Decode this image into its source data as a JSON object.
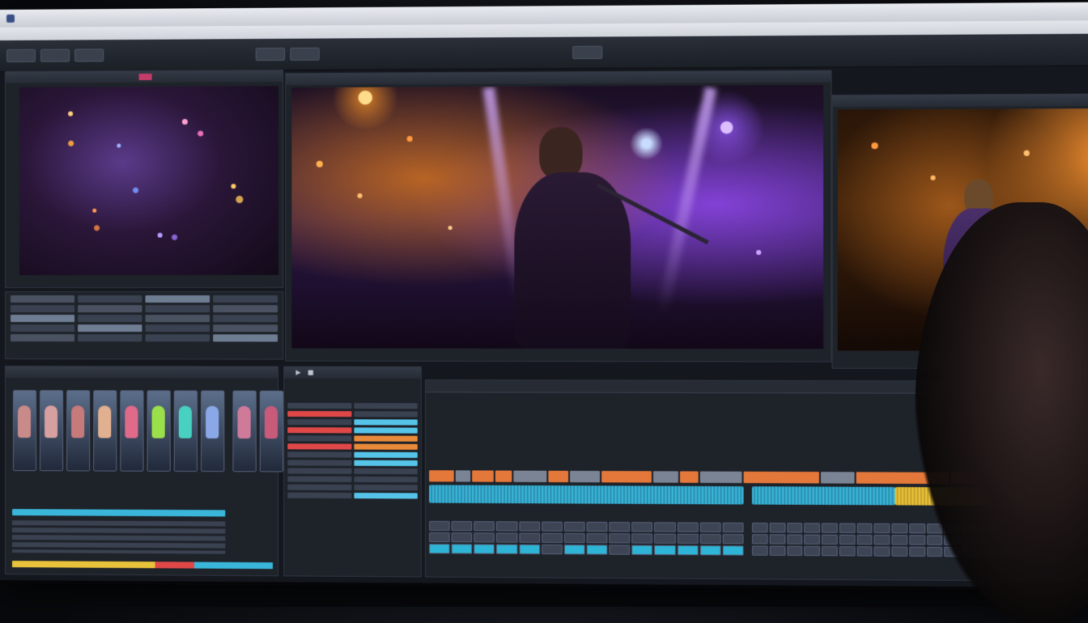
{
  "app": {
    "title": "",
    "menu": [
      "",
      "",
      "",
      "",
      ""
    ],
    "toolbar_buttons": [
      "",
      "",
      "",
      "",
      "",
      ""
    ]
  },
  "panels": {
    "source_monitor": {
      "title": "",
      "timecode": ""
    },
    "program_monitor": {
      "title": "",
      "timecode": ""
    },
    "aux_monitor": {
      "title": "",
      "timecode": ""
    },
    "bins": {
      "title": ""
    },
    "mixer": {
      "title": ""
    },
    "timeline": {
      "title": "",
      "ruler": ""
    }
  },
  "colors": {
    "accent_orange": "#e4783a",
    "accent_cyan": "#39b6d9",
    "accent_red": "#e04848",
    "accent_yellow": "#e8c23a",
    "panel_bg": "#1e2229"
  },
  "icons": [
    "app-logo-icon",
    "play-icon",
    "stop-icon",
    "record-icon"
  ]
}
